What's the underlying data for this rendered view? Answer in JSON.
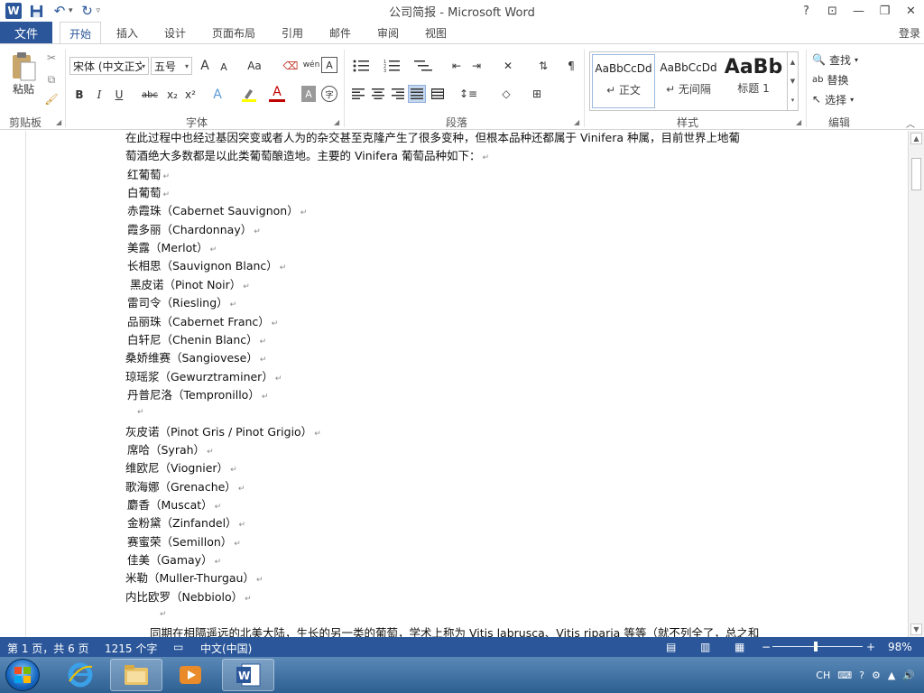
{
  "window": {
    "title": "公司简报 - Microsoft Word",
    "help": "?",
    "controls": [
      "⊡",
      "—",
      "❐",
      "✕"
    ]
  },
  "qat": {
    "undo_drop": "▾",
    "redo_drop": "▾",
    "more": "▿"
  },
  "tabs": {
    "file": "文件",
    "items": [
      "开始",
      "插入",
      "设计",
      "页面布局",
      "引用",
      "邮件",
      "审阅",
      "视图"
    ],
    "login": "登录"
  },
  "ribbon": {
    "clipboard": {
      "label": "剪贴板",
      "paste": "粘贴"
    },
    "font": {
      "label": "字体",
      "font_name": "宋体 (中文正文",
      "font_size": "五号",
      "grow": "A",
      "shrink": "A",
      "case": "Aa",
      "phonetic": "wén",
      "border_char": "A",
      "bold": "B",
      "italic": "I",
      "underline": "U",
      "strike": "abc",
      "subscript": "x₂",
      "superscript": "x²",
      "effects": "A",
      "color": "A",
      "shade": "A",
      "enclose": "字"
    },
    "paragraph": {
      "label": "段落"
    },
    "styles": {
      "label": "样式",
      "items": [
        {
          "sample": "AaBbCcDd",
          "name": "↵ 正文"
        },
        {
          "sample": "AaBbCcDd",
          "name": "↵ 无间隔"
        },
        {
          "sample": "AaBb",
          "name": "标题 1"
        }
      ]
    },
    "editing": {
      "label": "编辑",
      "find": "查找",
      "replace": "替换",
      "select": "选择"
    }
  },
  "document": {
    "lines": [
      "在此过程中也经过基因突变或者人为的杂交甚至克隆产生了很多变种，但根本品种还都属于 Vinifera 种属，目前世界上地葡",
      "萄酒绝大多数都是以此类葡萄酿造地。主要的 Vinifera 葡萄品种如下：",
      "红葡萄",
      "白葡萄",
      "赤霞珠（Cabernet Sauvignon）",
      "霞多丽（Chardonnay）",
      "美露（Merlot）",
      "长相思（Sauvignon Blanc）",
      "黑皮诺（Pinot Noir）",
      "雷司令（Riesling）",
      "品丽珠（Cabernet Franc）",
      "白轩尼（Chenin Blanc）",
      "桑娇维赛（Sangiovese）",
      "琼瑶浆（Gewurztraminer）",
      "丹普尼洛（Tempronillo）",
      "",
      "灰皮诺（Pinot Gris / Pinot Grigio）",
      "席哈（Syrah）",
      "维欧尼（Viognier）",
      "歌海娜（Grenache）",
      "麝香（Muscat）",
      "金粉黛（Zinfandel）",
      "赛蜜荣（Semillon）",
      "佳美（Gamay）",
      "米勒（Muller-Thurgau）",
      "内比欧罗（Nebbiolo）",
      "",
      "同期在相隔遥远的北美大陆，生长的另一类的葡萄，学术上称为 Vitis labrusca、Vitis riparia 等等（就不列全了，总之和"
    ],
    "pilcrow": "↵"
  },
  "status": {
    "page": "第 1 页，共 6 页",
    "words": "1215 个字",
    "language": "中文(中国)",
    "zoom_minus": "−",
    "zoom_plus": "+",
    "zoom": "98%",
    "zoom_level": 0.98
  },
  "tray": {
    "lang": "CH"
  },
  "colors": {
    "accent": "#2b579a",
    "taskbar": "#2d5f92"
  }
}
